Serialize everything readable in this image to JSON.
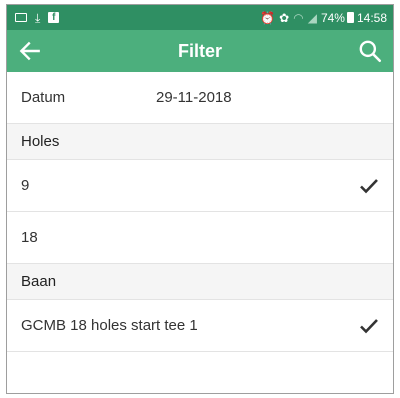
{
  "status_bar": {
    "left_icons": [
      "image-icon",
      "download-icon",
      "facebook-icon"
    ],
    "right_icons": [
      "alarm-icon",
      "notification-icon",
      "wifi-icon",
      "signal-icon"
    ],
    "battery": "74%",
    "time": "14:58",
    "colors": {
      "background": "#2f8f63"
    }
  },
  "app_bar": {
    "title": "Filter",
    "back_icon": "arrow-left-icon",
    "search_icon": "search-icon",
    "colors": {
      "background": "#4caf7d"
    }
  },
  "date_row": {
    "label": "Datum",
    "value": "29-11-2018"
  },
  "holes": {
    "header": "Holes",
    "options": [
      {
        "label": "9",
        "selected": true
      },
      {
        "label": "18",
        "selected": false
      }
    ]
  },
  "course": {
    "header": "Baan",
    "options": [
      {
        "label": "GCMB 18 holes start tee 1",
        "selected": true
      }
    ]
  }
}
